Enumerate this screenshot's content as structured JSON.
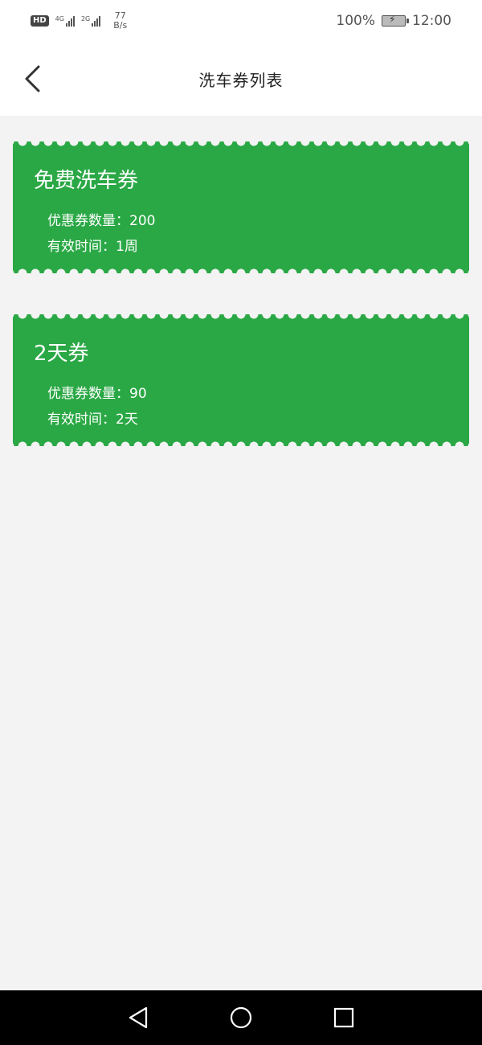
{
  "status": {
    "hd": "HD",
    "sim1": "4G",
    "sim2": "2G",
    "speed_value": "77",
    "speed_unit": "B/s",
    "battery": "100%",
    "time": "12:00"
  },
  "header": {
    "title": "洗车券列表",
    "back_icon": "chevron-left-icon"
  },
  "coupons": [
    {
      "name": "免费洗车券",
      "quantity": "优惠券数量：200",
      "validity": "有效时间：1周"
    },
    {
      "name": "2天券",
      "quantity": "优惠券数量：90",
      "validity": "有效时间：2天"
    }
  ],
  "colors": {
    "coupon_bg": "#2aa845",
    "page_bg": "#f3f3f3"
  },
  "nav": {
    "back_icon": "triangle-back-icon",
    "home_icon": "circle-home-icon",
    "recents_icon": "square-recents-icon"
  }
}
